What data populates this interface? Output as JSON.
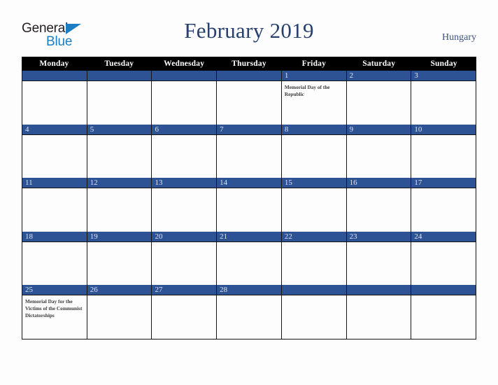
{
  "brand": {
    "name_part1": "General",
    "name_part2": "Blue",
    "triangle_icon": "blue-triangle-icon",
    "color_dark": "#231f20",
    "color_blue": "#1b7ec2"
  },
  "header": {
    "title": "February 2019",
    "country": "Hungary",
    "title_color": "#27406e"
  },
  "calendar": {
    "weekday_headers": [
      "Monday",
      "Tuesday",
      "Wednesday",
      "Thursday",
      "Friday",
      "Saturday",
      "Sunday"
    ],
    "header_bg": "#000000",
    "daynum_bg": "#2e5395",
    "weeks": [
      [
        {
          "day": "",
          "event": ""
        },
        {
          "day": "",
          "event": ""
        },
        {
          "day": "",
          "event": ""
        },
        {
          "day": "",
          "event": ""
        },
        {
          "day": "1",
          "event": "Memorial Day of the Republic"
        },
        {
          "day": "2",
          "event": ""
        },
        {
          "day": "3",
          "event": ""
        }
      ],
      [
        {
          "day": "4",
          "event": ""
        },
        {
          "day": "5",
          "event": ""
        },
        {
          "day": "6",
          "event": ""
        },
        {
          "day": "7",
          "event": ""
        },
        {
          "day": "8",
          "event": ""
        },
        {
          "day": "9",
          "event": ""
        },
        {
          "day": "10",
          "event": ""
        }
      ],
      [
        {
          "day": "11",
          "event": ""
        },
        {
          "day": "12",
          "event": ""
        },
        {
          "day": "13",
          "event": ""
        },
        {
          "day": "14",
          "event": ""
        },
        {
          "day": "15",
          "event": ""
        },
        {
          "day": "16",
          "event": ""
        },
        {
          "day": "17",
          "event": ""
        }
      ],
      [
        {
          "day": "18",
          "event": ""
        },
        {
          "day": "19",
          "event": ""
        },
        {
          "day": "20",
          "event": ""
        },
        {
          "day": "21",
          "event": ""
        },
        {
          "day": "22",
          "event": ""
        },
        {
          "day": "23",
          "event": ""
        },
        {
          "day": "24",
          "event": ""
        }
      ],
      [
        {
          "day": "25",
          "event": "Memorial Day for the Victims of the Communist Dictatorships"
        },
        {
          "day": "26",
          "event": ""
        },
        {
          "day": "27",
          "event": ""
        },
        {
          "day": "28",
          "event": ""
        },
        {
          "day": "",
          "event": ""
        },
        {
          "day": "",
          "event": ""
        },
        {
          "day": "",
          "event": ""
        }
      ]
    ]
  }
}
